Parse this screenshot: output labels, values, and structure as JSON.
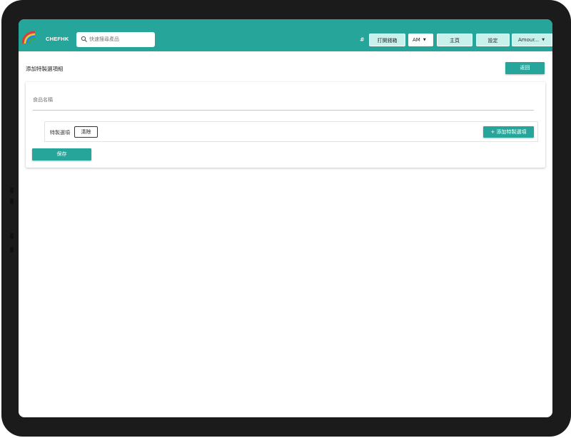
{
  "header": {
    "brand": "CHEFHK",
    "search": {
      "placeholder": "快速搜尋產品"
    },
    "hash_icon": "#",
    "open_drawer_label": "打開錢箱",
    "shift_select": {
      "value": "AM",
      "icon": "caret-down"
    },
    "home_label": "主頁",
    "settings_label": "設定",
    "user_label": "Amour...",
    "colors": {
      "bar": "#26a69a",
      "button_bg": "#c9f1ec"
    }
  },
  "page": {
    "title": "添加特製選項組",
    "back_label": "返回"
  },
  "form": {
    "food_name_placeholder": "食品名稱",
    "option_label": "特製選項",
    "clear_label": "清除",
    "add_option_label": "+ 添加特製選項",
    "save_label": "保存"
  }
}
